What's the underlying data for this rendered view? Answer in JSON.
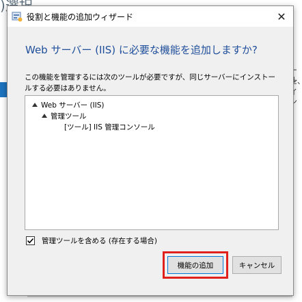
{
  "background": {
    "title_fragment": ")選択",
    "side_text": [
      "ール",
      "た、",
      "イン"
    ]
  },
  "dialog": {
    "title": "役割と機能の追加ウィザード",
    "close_glyph": "✕",
    "heading": "Web サーバー (IIS) に必要な機能を追加しますか?",
    "description": "この機能を管理するには次のツールが必要ですが、同じサーバーにインストールする必要はありません。",
    "tree": [
      {
        "level": 0,
        "expanded": true,
        "label": "Web サーバー (IIS)"
      },
      {
        "level": 1,
        "expanded": true,
        "label": "管理ツール"
      },
      {
        "level": 2,
        "expanded": false,
        "label": "[ツール] IIS 管理コンソール"
      }
    ],
    "checkbox": {
      "checked": true,
      "label": "管理ツールを含める (存在する場合)"
    },
    "buttons": {
      "add_label": "機能の追加",
      "cancel_label": "キャンセル"
    },
    "highlight_color": "#e0201b",
    "heading_color": "#1f4e9b"
  }
}
